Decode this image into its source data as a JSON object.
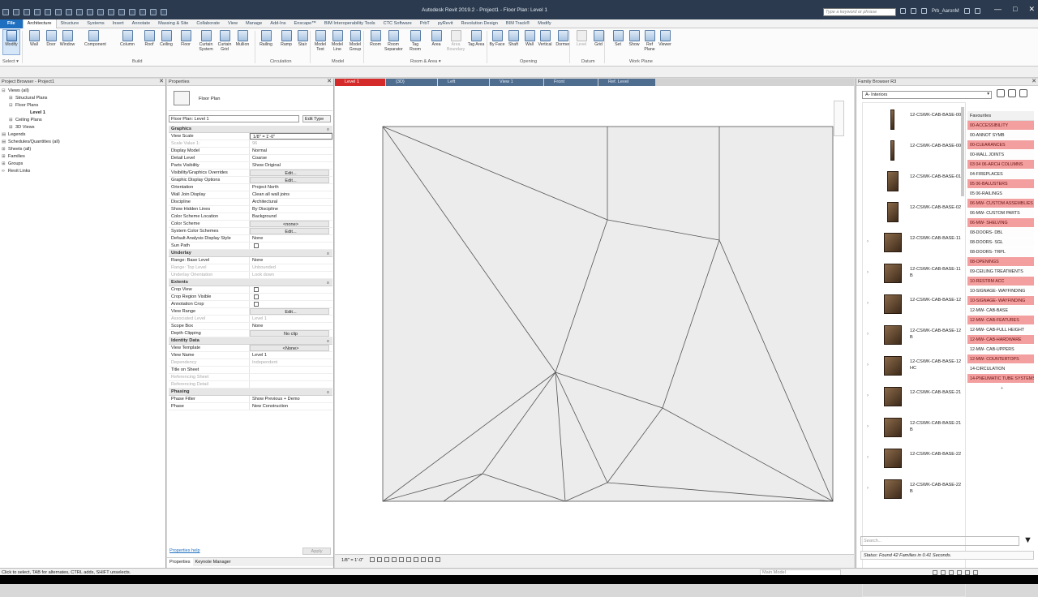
{
  "window": {
    "title": "Autodesk Revit 2019.2 - Project1 - Floor Plan: Level 1",
    "search_placeholder": "Type a keyword or phrase",
    "user": "Prb_AaronM",
    "info": "?",
    "controls": [
      "—",
      "□",
      "✕"
    ]
  },
  "ribbon_tabs": [
    "File",
    "Architecture",
    "Structure",
    "Systems",
    "Insert",
    "Annotate",
    "Massing & Site",
    "Collaborate",
    "View",
    "Manage",
    "Add-Ins",
    "Enscape™",
    "BIM Interoperability Tools",
    "CTC Software",
    "PrbT",
    "pyRevit",
    "Revolution Design",
    "BIM Track®",
    "Modify"
  ],
  "ribbon_buttons": [
    {
      "label": "Modify",
      "name": "modify-button"
    },
    {
      "label": "Wall",
      "name": "wall-button"
    },
    {
      "label": "Door",
      "name": "door-button"
    },
    {
      "label": "Window",
      "name": "window-button"
    },
    {
      "label": "Component",
      "name": "component-button"
    },
    {
      "label": "Column",
      "name": "column-button"
    },
    {
      "label": "Roof",
      "name": "roof-button"
    },
    {
      "label": "Ceiling",
      "name": "ceiling-button"
    },
    {
      "label": "Floor",
      "name": "floor-button"
    },
    {
      "label": "Curtain System",
      "name": "curtain-system-button"
    },
    {
      "label": "Curtain Grid",
      "name": "curtain-grid-button"
    },
    {
      "label": "Mullion",
      "name": "mullion-button"
    },
    {
      "label": "Railing",
      "name": "railing-button"
    },
    {
      "label": "Ramp",
      "name": "ramp-button"
    },
    {
      "label": "Stair",
      "name": "stair-button"
    },
    {
      "label": "Model Text",
      "name": "model-text-button"
    },
    {
      "label": "Model Line",
      "name": "model-line-button"
    },
    {
      "label": "Model Group",
      "name": "model-group-button"
    },
    {
      "label": "Room",
      "name": "room-button"
    },
    {
      "label": "Room Separator",
      "name": "room-separator-button"
    },
    {
      "label": "Tag Room",
      "name": "tag-room-button"
    },
    {
      "label": "Area",
      "name": "area-button"
    },
    {
      "label": "Area Boundary",
      "name": "area-boundary-button"
    },
    {
      "label": "Tag Area",
      "name": "tag-area-button"
    },
    {
      "label": "By Face",
      "name": "by-face-button"
    },
    {
      "label": "Shaft",
      "name": "shaft-button"
    },
    {
      "label": "Wall",
      "name": "opening-wall-button"
    },
    {
      "label": "Vertical",
      "name": "vertical-button"
    },
    {
      "label": "Dormer",
      "name": "dormer-button"
    },
    {
      "label": "Level",
      "name": "level-button"
    },
    {
      "label": "Grid",
      "name": "grid-button"
    },
    {
      "label": "Set",
      "name": "set-button"
    },
    {
      "label": "Show",
      "name": "show-button"
    },
    {
      "label": "Ref Plane",
      "name": "ref-plane-button"
    },
    {
      "label": "Viewer",
      "name": "viewer-button"
    }
  ],
  "ribbon_panels": [
    "Select ▾",
    "Build",
    "Circulation",
    "Model",
    "Room & Area ▾",
    "Opening",
    "Datum",
    "Work Plane"
  ],
  "project_browser": {
    "title": "Project Browser - Project1",
    "close": "✕",
    "items": [
      {
        "t": "⊟",
        "label": "Views (all)",
        "indent": 0
      },
      {
        "t": "⊞",
        "label": "Structural Plans",
        "indent": 1
      },
      {
        "t": "⊟",
        "label": "Floor Plans",
        "indent": 1
      },
      {
        "t": "",
        "label": "Level 1",
        "indent": 3,
        "bold": true
      },
      {
        "t": "⊞",
        "label": "Ceiling Plans",
        "indent": 1
      },
      {
        "t": "⊞",
        "label": "3D Views",
        "indent": 1
      },
      {
        "t": "▤",
        "label": "Legends",
        "indent": 0
      },
      {
        "t": "▤",
        "label": "Schedules/Quantities (all)",
        "indent": 0
      },
      {
        "t": "⊞",
        "label": "Sheets (all)",
        "indent": 0
      },
      {
        "t": "⊞",
        "label": "Families",
        "indent": 0
      },
      {
        "t": "⊞",
        "label": "Groups",
        "indent": 0
      },
      {
        "t": "∞",
        "label": "Revit Links",
        "indent": 0
      }
    ]
  },
  "properties": {
    "title": "Properties",
    "close": "✕",
    "family": "Floor Plan",
    "instance": "Floor Plan: Level 1",
    "edit_type": "Edit Type",
    "help": "Properties help",
    "apply": "Apply",
    "tabs": [
      "Properties",
      "Keynote Manager"
    ],
    "groups": [
      {
        "name": "Graphics",
        "rows": [
          [
            "View Scale",
            "1/8\" = 1'-0\"",
            "inp"
          ],
          [
            "Scale Value    1:",
            "96",
            "dis"
          ],
          [
            "Display Model",
            "Normal",
            ""
          ],
          [
            "Detail Level",
            "Coarse",
            ""
          ],
          [
            "Parts Visibility",
            "Show Original",
            ""
          ],
          [
            "Visibility/Graphics Overrides",
            "Edit...",
            "btn"
          ],
          [
            "Graphic Display Options",
            "Edit...",
            "btn"
          ],
          [
            "Orientation",
            "Project North",
            ""
          ],
          [
            "Wall Join Display",
            "Clean all wall joins",
            ""
          ],
          [
            "Discipline",
            "Architectural",
            ""
          ],
          [
            "Show Hidden Lines",
            "By Discipline",
            ""
          ],
          [
            "Color Scheme Location",
            "Background",
            ""
          ],
          [
            "Color Scheme",
            "<none>",
            "btn"
          ],
          [
            "System Color Schemes",
            "Edit...",
            "btn"
          ],
          [
            "Default Analysis Display Style",
            "None",
            ""
          ],
          [
            "Sun Path",
            "",
            "chk"
          ]
        ]
      },
      {
        "name": "Underlay",
        "rows": [
          [
            "Range: Base Level",
            "None",
            ""
          ],
          [
            "Range: Top Level",
            "Unbounded",
            "dis"
          ],
          [
            "Underlay Orientation",
            "Look down",
            "dis"
          ]
        ]
      },
      {
        "name": "Extents",
        "rows": [
          [
            "Crop View",
            "",
            "chk"
          ],
          [
            "Crop Region Visible",
            "",
            "chk"
          ],
          [
            "Annotation Crop",
            "",
            "chk"
          ],
          [
            "View Range",
            "Edit...",
            "btn"
          ],
          [
            "Associated Level",
            "Level 1",
            "dis"
          ],
          [
            "Scope Box",
            "None",
            ""
          ],
          [
            "Depth Clipping",
            "No clip",
            "btn"
          ]
        ]
      },
      {
        "name": "Identity Data",
        "rows": [
          [
            "View Template",
            "<None>",
            "btn"
          ],
          [
            "View Name",
            "Level 1",
            ""
          ],
          [
            "Dependency",
            "Independent",
            "dis"
          ],
          [
            "Title on Sheet",
            "",
            ""
          ],
          [
            "Referencing Sheet",
            "",
            "dis"
          ],
          [
            "Referencing Detail",
            "",
            "dis"
          ]
        ]
      },
      {
        "name": "Phasing",
        "rows": [
          [
            "Phase Filter",
            "Show Previous + Demo",
            ""
          ],
          [
            "Phase",
            "New Construction",
            ""
          ]
        ]
      }
    ]
  },
  "view_tabs": [
    {
      "label": "Level 1",
      "active": true
    },
    {
      "label": "{3D}",
      "active": false
    },
    {
      "label": "Left",
      "active": false
    },
    {
      "label": "View 1",
      "active": false
    },
    {
      "label": "Front",
      "active": false
    },
    {
      "label": "Ref. Level",
      "active": false
    }
  ],
  "view_control": {
    "scale": "1/8\" = 1'-0\""
  },
  "family_browser": {
    "title": "Family Browser R3",
    "close": "✕",
    "library": "A- Interiors",
    "favourites_title": "Favourites",
    "families": [
      "12-CSWK-CAB-BASE-00",
      "12-CSWK-CAB-BASE-00I",
      "12-CSWK-CAB-BASE-01",
      "12-CSWK-CAB-BASE-02",
      "12-CSWK-CAB-BASE-11",
      "12-CSWK-CAB-BASE-11B",
      "12-CSWK-CAB-BASE-12",
      "12-CSWK-CAB-BASE-12B",
      "12-CSWK-CAB-BASE-12HC",
      "12-CSWK-CAB-BASE-21",
      "12-CSWK-CAB-BASE-21B",
      "12-CSWK-CAB-BASE-22",
      "12-CSWK-CAB-BASE-22B"
    ],
    "favourites": [
      {
        "l": "00-ACCESSIBILITY",
        "r": true
      },
      {
        "l": "00-ANNOT SYMB",
        "r": false
      },
      {
        "l": "00-CLEARANCES",
        "r": true
      },
      {
        "l": "00-WALL JOINTS",
        "r": false
      },
      {
        "l": "03 04 06-ARCH COLUMNS",
        "r": true
      },
      {
        "l": "04-FIREPLACES",
        "r": false
      },
      {
        "l": "05 06-BALUSTERS",
        "r": true
      },
      {
        "l": "05 06-RAILINGS",
        "r": false
      },
      {
        "l": "06-MW- CUSTOM ASSEMBLIES",
        "r": true
      },
      {
        "l": "06-MW- CUSTOM PARTS",
        "r": false
      },
      {
        "l": "06-MW- SHELVING",
        "r": true
      },
      {
        "l": "08-DOORS- DBL",
        "r": false
      },
      {
        "l": "08-DOORS- SGL",
        "r": false
      },
      {
        "l": "08-DOORS- TRPL",
        "r": false
      },
      {
        "l": "08-OPENINGS",
        "r": true
      },
      {
        "l": "09-CEILING TREATMENTS",
        "r": false
      },
      {
        "l": "10-RESTRM ACC",
        "r": true
      },
      {
        "l": "10-SIGNAGE- WAYFINDING",
        "r": false
      },
      {
        "l": "10-SIGNAGE- WAYFINDING",
        "r": true
      },
      {
        "l": "12-MW- CAB-BASE",
        "r": false
      },
      {
        "l": "12-MW- CAB-FEATURES",
        "r": true
      },
      {
        "l": "12-MW- CAB-FULL HEIGHT",
        "r": false
      },
      {
        "l": "12-MW- CAB-HARDWARE",
        "r": true
      },
      {
        "l": "12-MW- CAB-UPPERS",
        "r": false
      },
      {
        "l": "12-MW- COUNTERTOPS",
        "r": true
      },
      {
        "l": "14-CIRCULATION",
        "r": false
      },
      {
        "l": "14-PNEUMATIC TUBE SYSTEMS",
        "r": true
      }
    ],
    "search_placeholder": "Search...",
    "status": "Status: Found 42 Families in 0.41 Seconds."
  },
  "statusbar": {
    "message": "Click to select, TAB for alternates, CTRL adds, SHIFT unselects.",
    "workset": "Main Model",
    "zero": ":0"
  }
}
